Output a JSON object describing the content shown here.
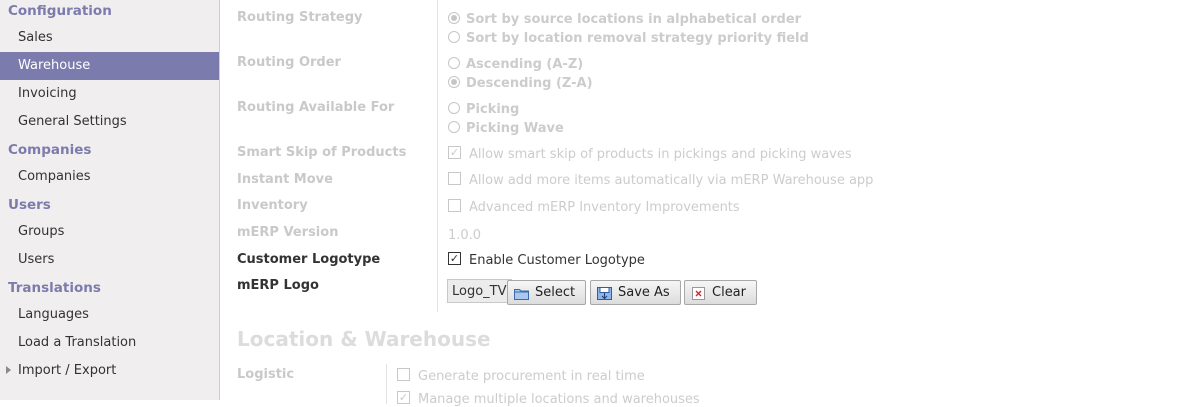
{
  "sidebar": {
    "sections": [
      {
        "title": "Configuration",
        "items": [
          {
            "label": "Sales"
          },
          {
            "label": "Warehouse",
            "active": true
          },
          {
            "label": "Invoicing"
          },
          {
            "label": "General Settings"
          }
        ]
      },
      {
        "title": "Companies",
        "items": [
          {
            "label": "Companies"
          }
        ]
      },
      {
        "title": "Users",
        "items": [
          {
            "label": "Groups"
          },
          {
            "label": "Users"
          }
        ]
      },
      {
        "title": "Translations",
        "items": [
          {
            "label": "Languages"
          },
          {
            "label": "Load a Translation"
          },
          {
            "label": "Import / Export"
          }
        ]
      }
    ]
  },
  "form": {
    "routing_strategy": {
      "label": "Routing Strategy",
      "opt1": "Sort by source locations in alphabetical order",
      "opt2": "Sort by location removal strategy priority field",
      "selected": "opt1"
    },
    "routing_order": {
      "label": "Routing Order",
      "opt1": "Ascending (A-Z)",
      "opt2": "Descending (Z-A)",
      "selected": "opt2"
    },
    "routing_available_for": {
      "label": "Routing Available For",
      "opt1": "Picking",
      "opt2": "Picking Wave"
    },
    "smart_skip": {
      "label": "Smart Skip of Products",
      "text": "Allow smart skip of products in pickings and picking waves",
      "checked": true
    },
    "instant_move": {
      "label": "Instant Move",
      "text": "Allow add more items automatically via mERP Warehouse app",
      "checked": false
    },
    "inventory": {
      "label": "Inventory",
      "text": "Advanced mERP Inventory Improvements",
      "checked": false
    },
    "merp_version": {
      "label": "mERP Version",
      "value": "1.0.0"
    },
    "customer_logotype": {
      "label": "Customer Logotype",
      "text": "Enable Customer Logotype",
      "checked": true
    },
    "merp_logo": {
      "label": "mERP Logo",
      "filename": "Logo_TV",
      "select_label": "Select",
      "save_as_label": "Save As",
      "clear_label": "Clear"
    }
  },
  "location_section": {
    "title": "Location & Warehouse",
    "logistic": {
      "label": "Logistic",
      "opt1": "Generate procurement in real time",
      "opt2": "Manage multiple locations and warehouses"
    }
  },
  "colors": {
    "accent": "#7c7bad",
    "disabled_text": "#c9c9c9"
  }
}
